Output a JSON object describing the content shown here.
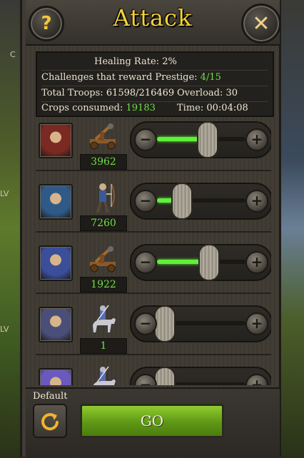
{
  "header": {
    "title": "Attack",
    "help_label": "?",
    "close_label": "✕"
  },
  "info": {
    "healing_rate_label": "Healing Rate:",
    "healing_rate_value": "2%",
    "prestige_label": "Challenges that reward Prestige:",
    "prestige_value": "4/15",
    "troops_label": "Total Troops:",
    "troops_value": "61598/216469",
    "overload_label": "Overload:",
    "overload_value": "30",
    "crops_label": "Crops consumed:",
    "crops_value": "19183",
    "time_label": "Time:",
    "time_value": "00:04:08"
  },
  "troops": [
    {
      "count": "3962",
      "unit_icon": "catapult-icon",
      "level": 0.5,
      "portrait_color": "#7a2a22"
    },
    {
      "count": "7260",
      "unit_icon": "archer-icon",
      "level": 0.2,
      "portrait_color": "#2f5a88"
    },
    {
      "count": "1922",
      "unit_icon": "catapult-icon",
      "level": 0.52,
      "portrait_color": "#3a4e9a"
    },
    {
      "count": "1",
      "unit_icon": "cavalry-icon",
      "level": 0.0,
      "portrait_color": "#4a4f7a"
    },
    {
      "count": "",
      "unit_icon": "cavalry-icon",
      "level": 0.0,
      "portrait_color": "#6a5abf"
    }
  ],
  "footer": {
    "default_label": "Default",
    "go_label": "GO"
  },
  "side_tags": {
    "lv": "LV",
    "cl": "C"
  }
}
